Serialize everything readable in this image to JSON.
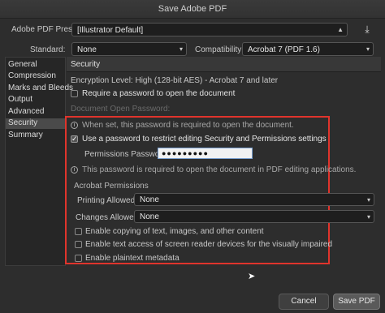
{
  "window": {
    "title": "Save Adobe PDF"
  },
  "preset": {
    "label": "Adobe PDF Preset:",
    "value": "[Illustrator Default]"
  },
  "standard": {
    "label": "Standard:",
    "value": "None"
  },
  "compatibility": {
    "label": "Compatibility:",
    "value": "Acrobat 7 (PDF 1.6)"
  },
  "sidebar": {
    "items": [
      {
        "label": "General"
      },
      {
        "label": "Compression"
      },
      {
        "label": "Marks and Bleeds"
      },
      {
        "label": "Output"
      },
      {
        "label": "Advanced"
      },
      {
        "label": "Security"
      },
      {
        "label": "Summary"
      }
    ],
    "selected": "Security"
  },
  "security": {
    "heading": "Security",
    "encryption": "Encryption Level:   High (128-bit AES) - Acrobat 7 and later",
    "require_open_pw": "Require a password to open the document",
    "doc_open_pw_label": "Document Open Password:",
    "open_pw_info": "When set, this password is required to open the document.",
    "use_restrict_pw": "Use a password to restrict editing Security and Permissions settings",
    "permissions_pw_label": "Permissions Password:",
    "permissions_pw_value": "●●●●●●●●●",
    "perm_pw_info": "This password is required to open the document in PDF editing applications.",
    "acrobat_permissions": "Acrobat Permissions",
    "printing_label": "Printing Allowed:",
    "printing_value": "None",
    "changes_label": "Changes Allowed:",
    "changes_value": "None",
    "enable_copying": "Enable copying of text, images, and other content",
    "enable_screen_reader": "Enable text access of screen reader devices for the visually impaired",
    "enable_plaintext": "Enable plaintext metadata"
  },
  "buttons": {
    "cancel": "Cancel",
    "save": "Save PDF"
  },
  "colors": {
    "highlight_border": "#e0342c",
    "background": "#2d2d2d"
  }
}
